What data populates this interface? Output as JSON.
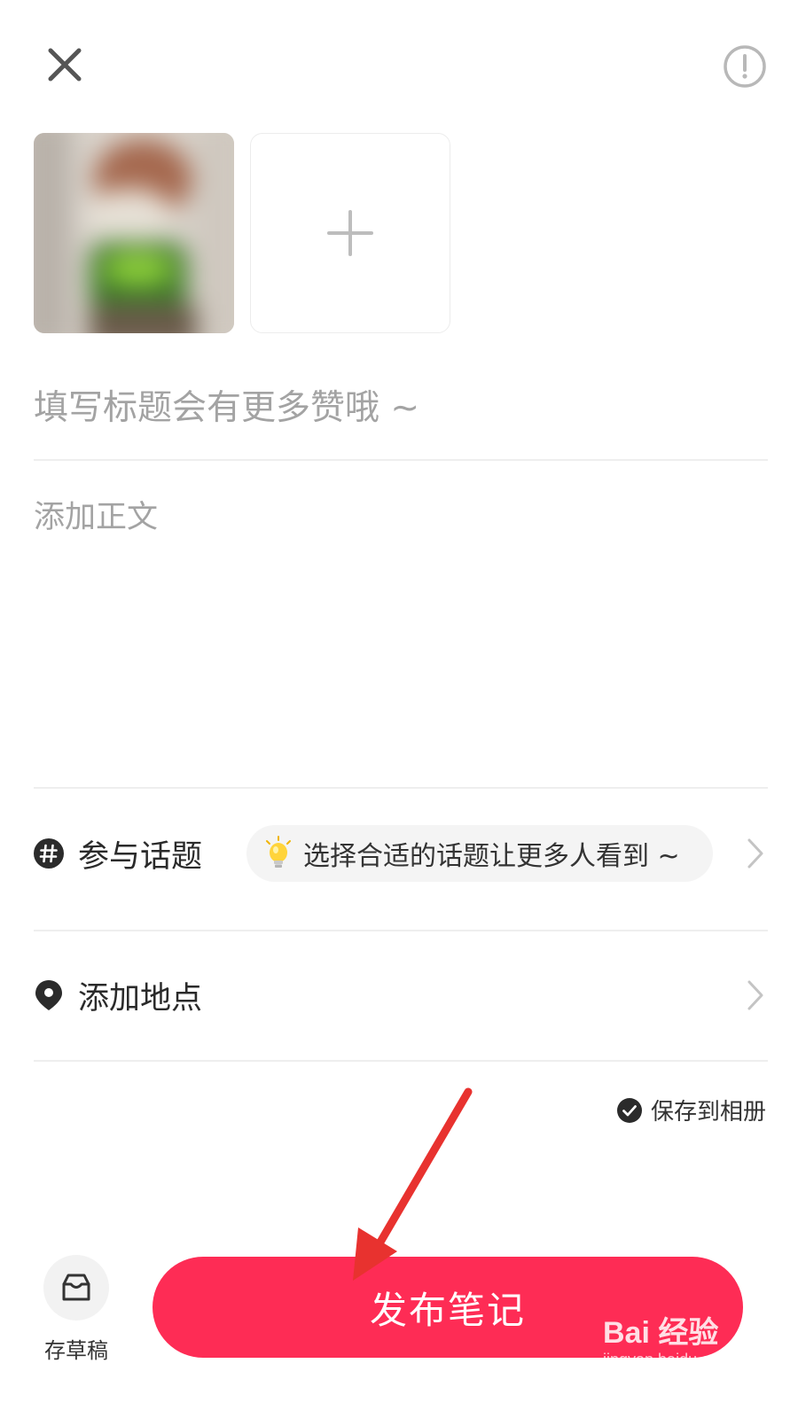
{
  "header": {
    "close_icon": "close-icon",
    "info_icon": "exclamation-circle-icon"
  },
  "media": {
    "photo_alt": "blurred photo",
    "add_icon": "plus-icon"
  },
  "editor": {
    "title_placeholder": "填写标题会有更多赞哦 ~",
    "body_placeholder": "添加正文"
  },
  "topic": {
    "icon": "hashtag-icon",
    "label": "参与话题",
    "hint_icon": "lightbulb-icon",
    "hint": "选择合适的话题让更多人看到 ~"
  },
  "location": {
    "icon": "location-pin-icon",
    "label": "添加地点"
  },
  "save_album": {
    "icon": "check-circle-icon",
    "label": "保存到相册",
    "checked": true
  },
  "bottom": {
    "draft_icon": "inbox-icon",
    "draft_label": "存草稿",
    "publish_label": "发布笔记"
  },
  "watermark": {
    "brand": "Bai 经验",
    "url": "jingyan.baidu.com"
  },
  "colors": {
    "primary": "#fe2c55",
    "annotation_arrow": "#e8322f",
    "placeholder": "#a3a3a3",
    "divider": "#eeeeee"
  }
}
